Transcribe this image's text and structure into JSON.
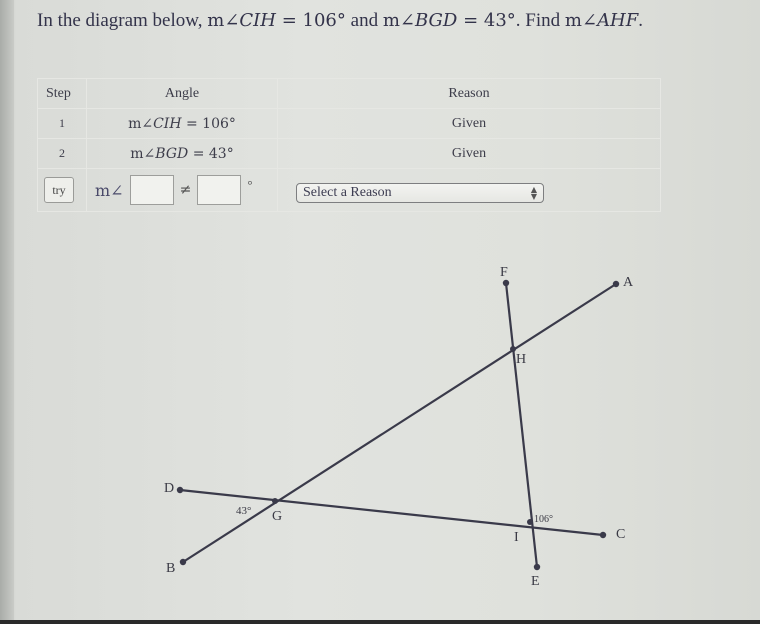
{
  "question": {
    "prefix": "In the diagram below, ",
    "given1_m": "m∠",
    "given1_name": "CIH",
    "given1_value": " = 106°",
    "connector": " and ",
    "given2_m": "m∠",
    "given2_name": "BGD",
    "given2_value": " = 43°",
    "find_prefix": ". Find ",
    "find_m": "m∠",
    "find_name": "AHF",
    "find_suffix": "."
  },
  "table": {
    "headers": {
      "step": "Step",
      "angle": "Angle",
      "reason": "Reason"
    },
    "rows": [
      {
        "step": "1",
        "angle_m": "m∠",
        "angle_name": "CIH",
        "angle_value": " = 106°",
        "reason": "Given"
      },
      {
        "step": "2",
        "angle_m": "m∠",
        "angle_name": "BGD",
        "angle_value": " = 43°",
        "reason": "Given"
      }
    ],
    "try_row": {
      "try_label": "try",
      "m_angle": "m∠",
      "angle_input_value": "",
      "relation_symbol": "≠",
      "value_input_value": "",
      "degree_symbol": "°",
      "reason_select": "Select a Reason",
      "select_icon": "up-down-arrows"
    }
  },
  "diagram": {
    "points": [
      "F",
      "A",
      "H",
      "D",
      "G",
      "B",
      "I",
      "C",
      "E"
    ],
    "angle_labels": {
      "at_G": "43°",
      "at_I": "106°"
    }
  }
}
